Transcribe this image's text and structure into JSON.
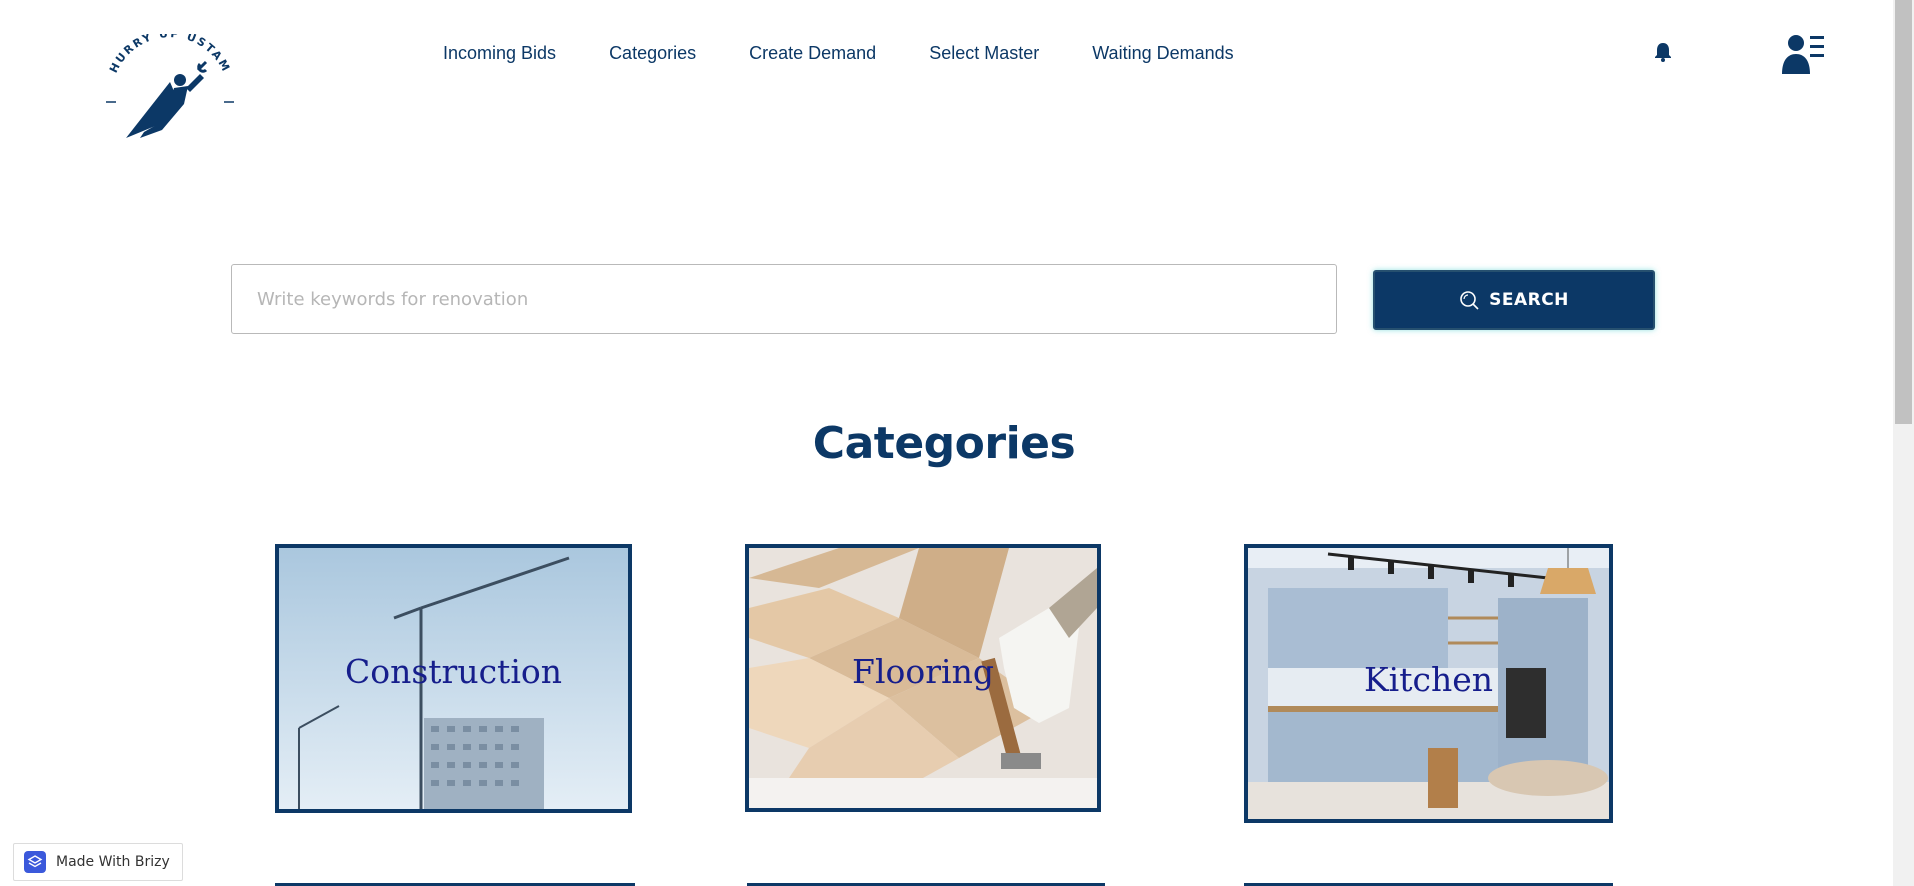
{
  "brand": {
    "logo_text": "HURRY UP USTAM"
  },
  "nav": {
    "items": [
      {
        "label": "Incoming Bids"
      },
      {
        "label": "Categories"
      },
      {
        "label": "Create Demand"
      },
      {
        "label": "Select Master"
      },
      {
        "label": "Waiting Demands"
      }
    ],
    "notification_icon": "bell-icon",
    "account_icon": "user-menu-icon"
  },
  "search": {
    "placeholder": "Write keywords for renovation",
    "value": "",
    "button_label": "SEARCH",
    "button_icon": "search-icon"
  },
  "categories": {
    "title": "Categories",
    "items": [
      {
        "label": "Construction"
      },
      {
        "label": "Flooring"
      },
      {
        "label": "Kitchen"
      }
    ]
  },
  "badge": {
    "label": "Made With Brizy"
  },
  "colors": {
    "primary": "#0c3866",
    "card_label": "#161e8c",
    "button_glow": "#3cc8c8",
    "placeholder": "#b6b6b6"
  }
}
